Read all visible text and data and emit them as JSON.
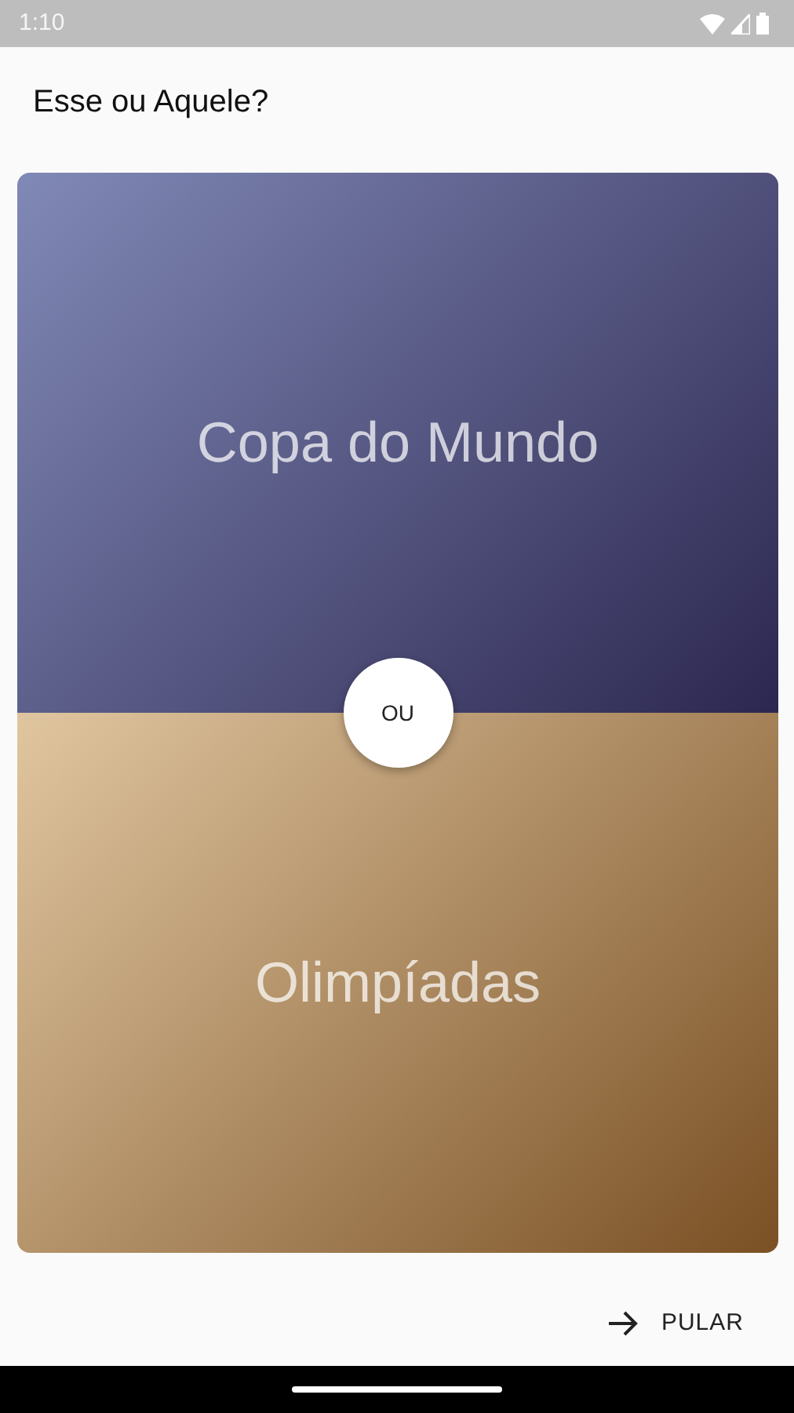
{
  "status_bar": {
    "time": "1:10"
  },
  "title": "Esse ou Aquele?",
  "options": [
    {
      "label": "Copa do Mundo",
      "kind": "top"
    },
    {
      "label": "Olimpíadas",
      "kind": "bottom"
    }
  ],
  "divider_label": "OU",
  "skip_button": {
    "label": "PULAR"
  }
}
